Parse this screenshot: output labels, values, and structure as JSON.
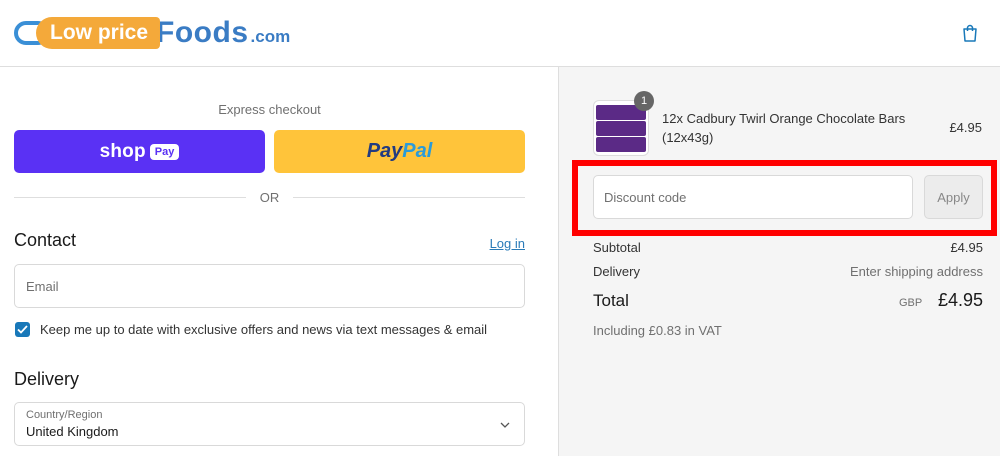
{
  "header": {
    "logo": {
      "part1": "Low price",
      "part2": "Foods",
      "part3": ".com"
    },
    "cart_icon": "shopping-bag-icon"
  },
  "checkout": {
    "express_title": "Express checkout",
    "shop_pay": {
      "text": "shop",
      "badge": "Pay"
    },
    "paypal": {
      "part1": "Pay",
      "part2": "Pal"
    },
    "or": "OR",
    "contact": {
      "title": "Contact",
      "login": "Log in",
      "email_placeholder": "Email",
      "marketing_opt_in": "Keep me up to date with exclusive offers and news via text messages & email",
      "opt_in_checked": true
    },
    "delivery": {
      "title": "Delivery",
      "country_label": "Country/Region",
      "country_value": "United Kingdom"
    }
  },
  "order": {
    "item": {
      "name": "12x Cadbury Twirl Orange Chocolate Bars (12x43g)",
      "quantity": "1",
      "price": "£4.95"
    },
    "discount": {
      "placeholder": "Discount code",
      "apply": "Apply"
    },
    "subtotal_label": "Subtotal",
    "subtotal_value": "£4.95",
    "delivery_label": "Delivery",
    "delivery_value": "Enter shipping address",
    "total_label": "Total",
    "currency": "GBP",
    "total_value": "£4.95",
    "vat_note": "Including £0.83 in VAT"
  },
  "colors": {
    "shop_pay": "#5a31f4",
    "paypal": "#ffc43a",
    "link": "#2a7bb8",
    "highlight": "#ff0000",
    "checkbox": "#1878b9"
  }
}
